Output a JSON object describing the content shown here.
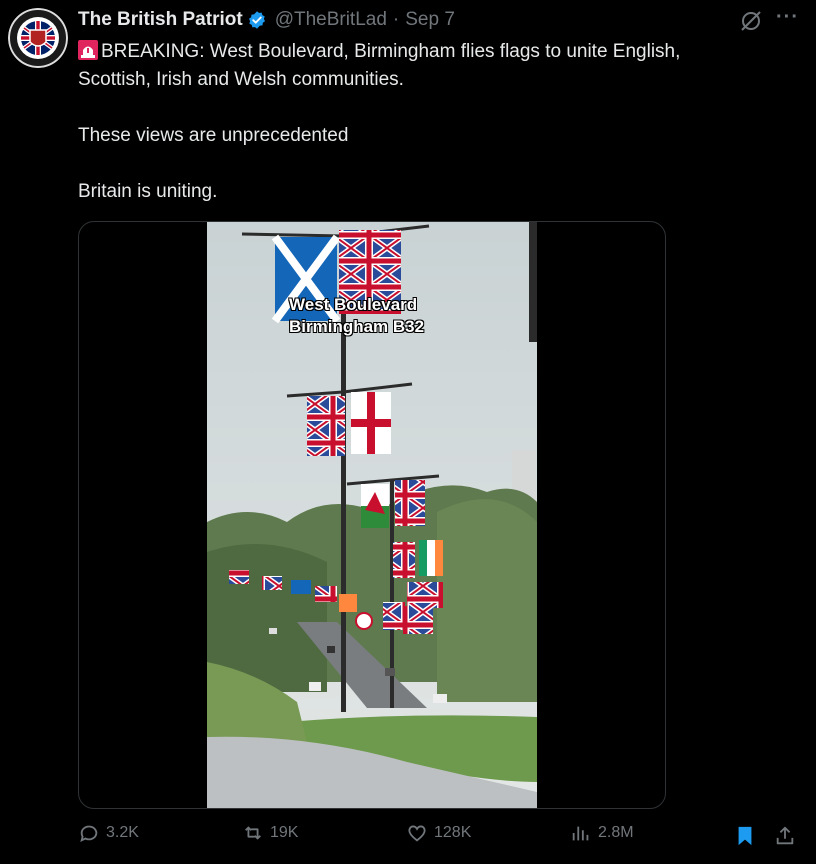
{
  "post": {
    "display_name": "The British Patriot",
    "handle": "@TheBritLad",
    "separator": "·",
    "date": "Sep 7",
    "more_label": "···",
    "text_lines": {
      "line1": "BREAKING: West Boulevard, Birmingham flies flags to unite English,",
      "line2": "Scottish, Irish and Welsh communities.",
      "line3": "These views are unprecedented",
      "line4": "Britain is uniting."
    },
    "video_overlay": {
      "line1": "West Boulevard",
      "line2": "Birmingham B32"
    }
  },
  "actions": {
    "replies": "3.2K",
    "reposts": "19K",
    "likes": "128K",
    "views": "2.8M"
  },
  "icons": {
    "verified": "verified-badge-icon",
    "siren": "siren-icon",
    "grok": "grok-icon",
    "reply": "reply-icon",
    "repost": "repost-icon",
    "like": "heart-icon",
    "views": "views-chart-icon",
    "bookmark": "bookmark-icon",
    "share": "share-icon"
  },
  "colors": {
    "background": "#000000",
    "text": "#e7e9ea",
    "muted": "#71767b",
    "verified": "#1d9bf0",
    "bookmark": "#1d9bf0"
  }
}
